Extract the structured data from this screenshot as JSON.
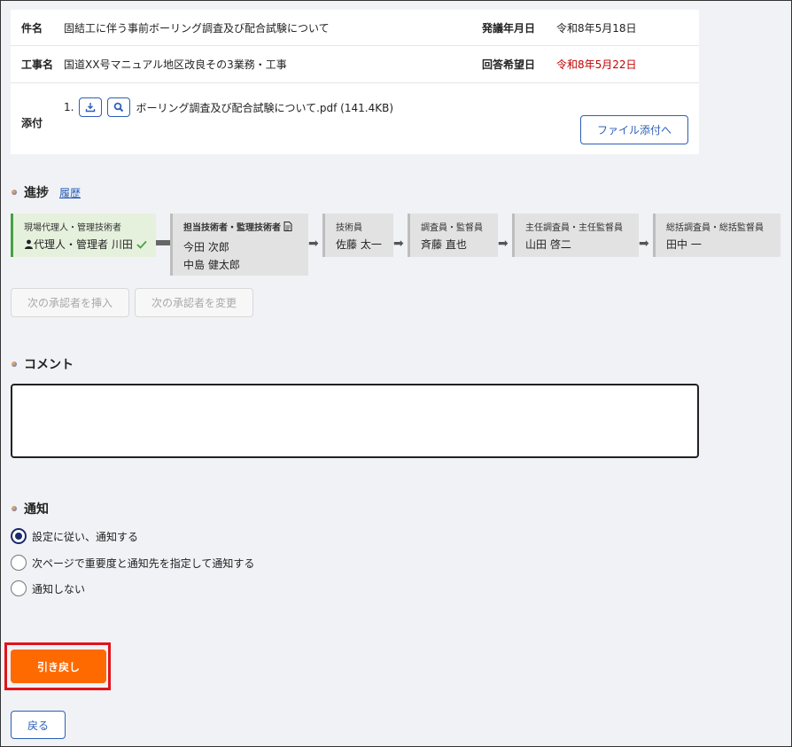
{
  "info": {
    "subject_label": "件名",
    "subject": "固結工に伴う事前ボーリング調査及び配合試験について",
    "issue_date_label": "発議年月日",
    "issue_date": "令和8年5月18日",
    "project_label": "工事名",
    "project": "国道XX号マニュアル地区改良その3業務・工事",
    "reply_date_label": "回答希望日",
    "reply_date": "令和8年5月22日",
    "attach_label": "添付",
    "attach_index": "1.",
    "attach_file": "ボーリング調査及び配合試験について.pdf (141.4KB)",
    "file_attach_button": "ファイル添付へ"
  },
  "progress": {
    "title": "進捗",
    "history_link": "履歴",
    "steps": [
      {
        "role": "現場代理人・管理技術者",
        "name": "代理人・管理者 川田"
      },
      {
        "role": "担当技術者・監理技術者",
        "name1": "今田 次郎",
        "name2": "中島 健太郎"
      },
      {
        "role": "技術員",
        "name": "佐藤 太一"
      },
      {
        "role": "調査員・監督員",
        "name": "斉藤 直也"
      },
      {
        "role": "主任調査員・主任監督員",
        "name": "山田 啓二"
      },
      {
        "role": "総括調査員・総括監督員",
        "name": "田中 一"
      }
    ],
    "insert_button": "次の承認者を挿入",
    "change_button": "次の承認者を変更"
  },
  "comment": {
    "title": "コメント",
    "value": ""
  },
  "notification": {
    "title": "通知",
    "options": [
      {
        "label": "設定に従い、通知する",
        "checked": true
      },
      {
        "label": "次ページで重要度と通知先を指定して通知する",
        "checked": false
      },
      {
        "label": "通知しない",
        "checked": false
      }
    ]
  },
  "actions": {
    "pullback_button": "引き戻し",
    "back_button": "戻る"
  },
  "colors": {
    "accent_blue": "#2c5fb8",
    "primary_orange": "#ff6a00",
    "alert_red": "#c00000",
    "done_green": "#49a045"
  }
}
